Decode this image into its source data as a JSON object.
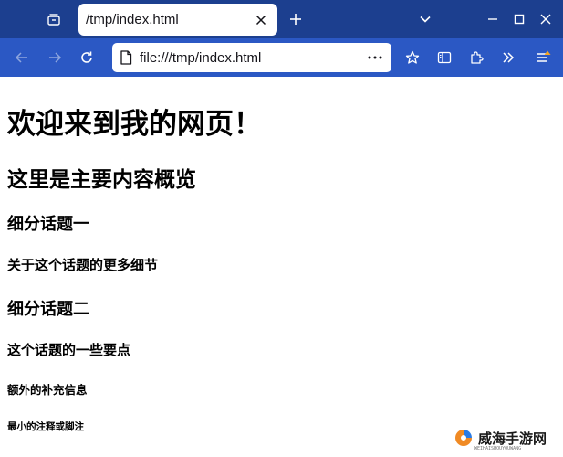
{
  "browser": {
    "tab": {
      "title": "/tmp/index.html"
    },
    "url": "file:///tmp/index.html",
    "colors": {
      "tabbar": "#1c3f8f",
      "toolbar": "#2b58c4"
    },
    "icons": {
      "tab_list": "tab-list-icon",
      "close_tab": "close-icon",
      "new_tab": "plus-icon",
      "overflow": "chevron-down-icon",
      "minimize": "minimize-icon",
      "maximize": "maximize-icon",
      "close_window": "close-icon",
      "back": "arrow-left-icon",
      "forward": "arrow-right-icon",
      "reload": "reload-icon",
      "more": "ellipsis-icon",
      "pocket": "star-icon",
      "sidebar": "sidebar-icon",
      "extensions": "puzzle-icon",
      "overflow_menu": "double-chevron-icon",
      "app_menu": "hamburger-icon"
    }
  },
  "page": {
    "h1": "欢迎来到我的网页！",
    "h2": "这里是主要内容概览",
    "h3_1": "细分话题一",
    "h4_1": "关于这个话题的更多细节",
    "h3_2": "细分话题二",
    "h4_2": "这个话题的一些要点",
    "h5": "额外的补充信息",
    "h6": "最小的注释或脚注"
  },
  "watermark": {
    "text": "威海手游网",
    "sub": "WEIHAISHOUYOUWANG"
  }
}
